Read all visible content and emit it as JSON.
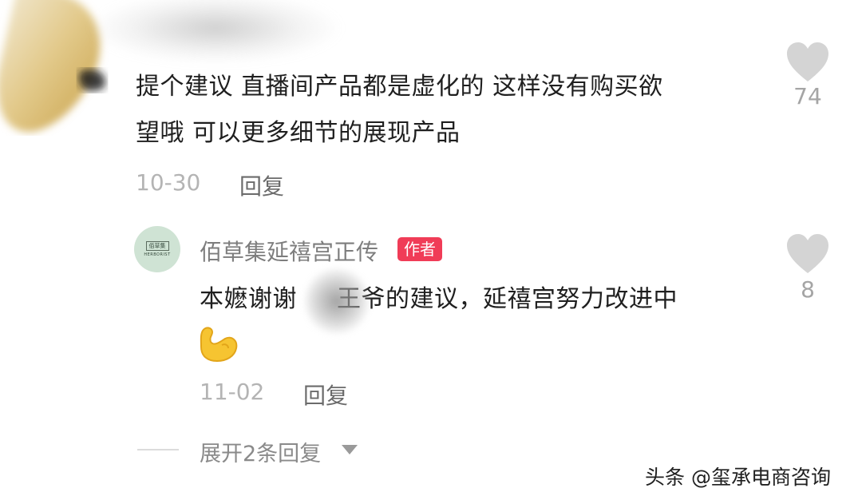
{
  "comment": {
    "text_line1": "提个建议 直播间产品都是虚化的 这样没有购买欲",
    "text_line2": "望哦 可以更多细节的展现产品",
    "date": "10-30",
    "reply_label": "回复",
    "likes": "74",
    "like_icon": "heart-icon"
  },
  "reply": {
    "username": "佰草集延禧宫正传",
    "badge": "作者",
    "avatar_logo_text": "佰草集",
    "avatar_logo_subtext": "HERBORIST",
    "text_part1": "本嬷谢谢",
    "text_part2": "王爷的建议，延禧宫努力改进中",
    "emoji": "flexed-biceps",
    "date": "11-02",
    "reply_label": "回复",
    "likes": "8",
    "like_icon": "heart-icon"
  },
  "expand": {
    "label": "展开2条回复",
    "icon": "caret-down-icon"
  },
  "watermark": "头条 @玺承电商咨询",
  "colors": {
    "badge_bg": "#f03c57",
    "heart": "#d4d4d4",
    "text": "#1f1f1f",
    "muted": "#b4b4b4"
  }
}
